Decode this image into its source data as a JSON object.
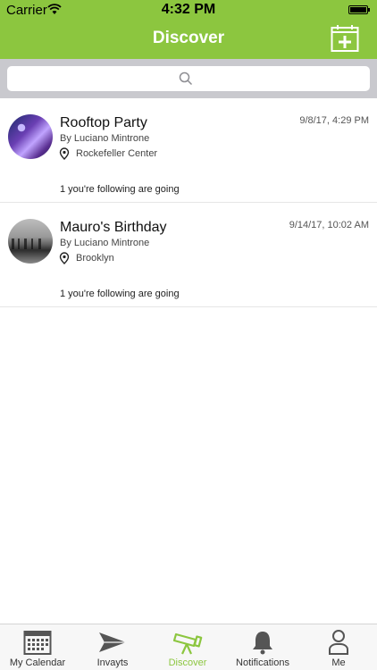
{
  "status_bar": {
    "carrier": "Carrier",
    "time": "4:32 PM"
  },
  "nav": {
    "title": "Discover",
    "add_event_icon": "calendar-plus-icon"
  },
  "search": {
    "placeholder": "",
    "icon": "search-icon"
  },
  "events": [
    {
      "title": "Rooftop Party",
      "by": "By Luciano Mintrone",
      "location": "Rockefeller Center",
      "date": "9/8/17, 4:29 PM",
      "following": "1 you're following are going"
    },
    {
      "title": "Mauro's Birthday",
      "by": "By Luciano Mintrone",
      "location": "Brooklyn",
      "date": "9/14/17, 10:02 AM",
      "following": "1 you're following are going"
    }
  ],
  "tabbar": {
    "items": [
      {
        "label": "My Calendar",
        "icon": "calendar-icon"
      },
      {
        "label": "Invayts",
        "icon": "paper-plane-icon"
      },
      {
        "label": "Discover",
        "icon": "telescope-icon"
      },
      {
        "label": "Notifications",
        "icon": "bell-icon"
      },
      {
        "label": "Me",
        "icon": "person-icon"
      }
    ],
    "active": "Discover",
    "active_color": "#8cc63f"
  },
  "colors": {
    "brand_green": "#8cc63f"
  }
}
